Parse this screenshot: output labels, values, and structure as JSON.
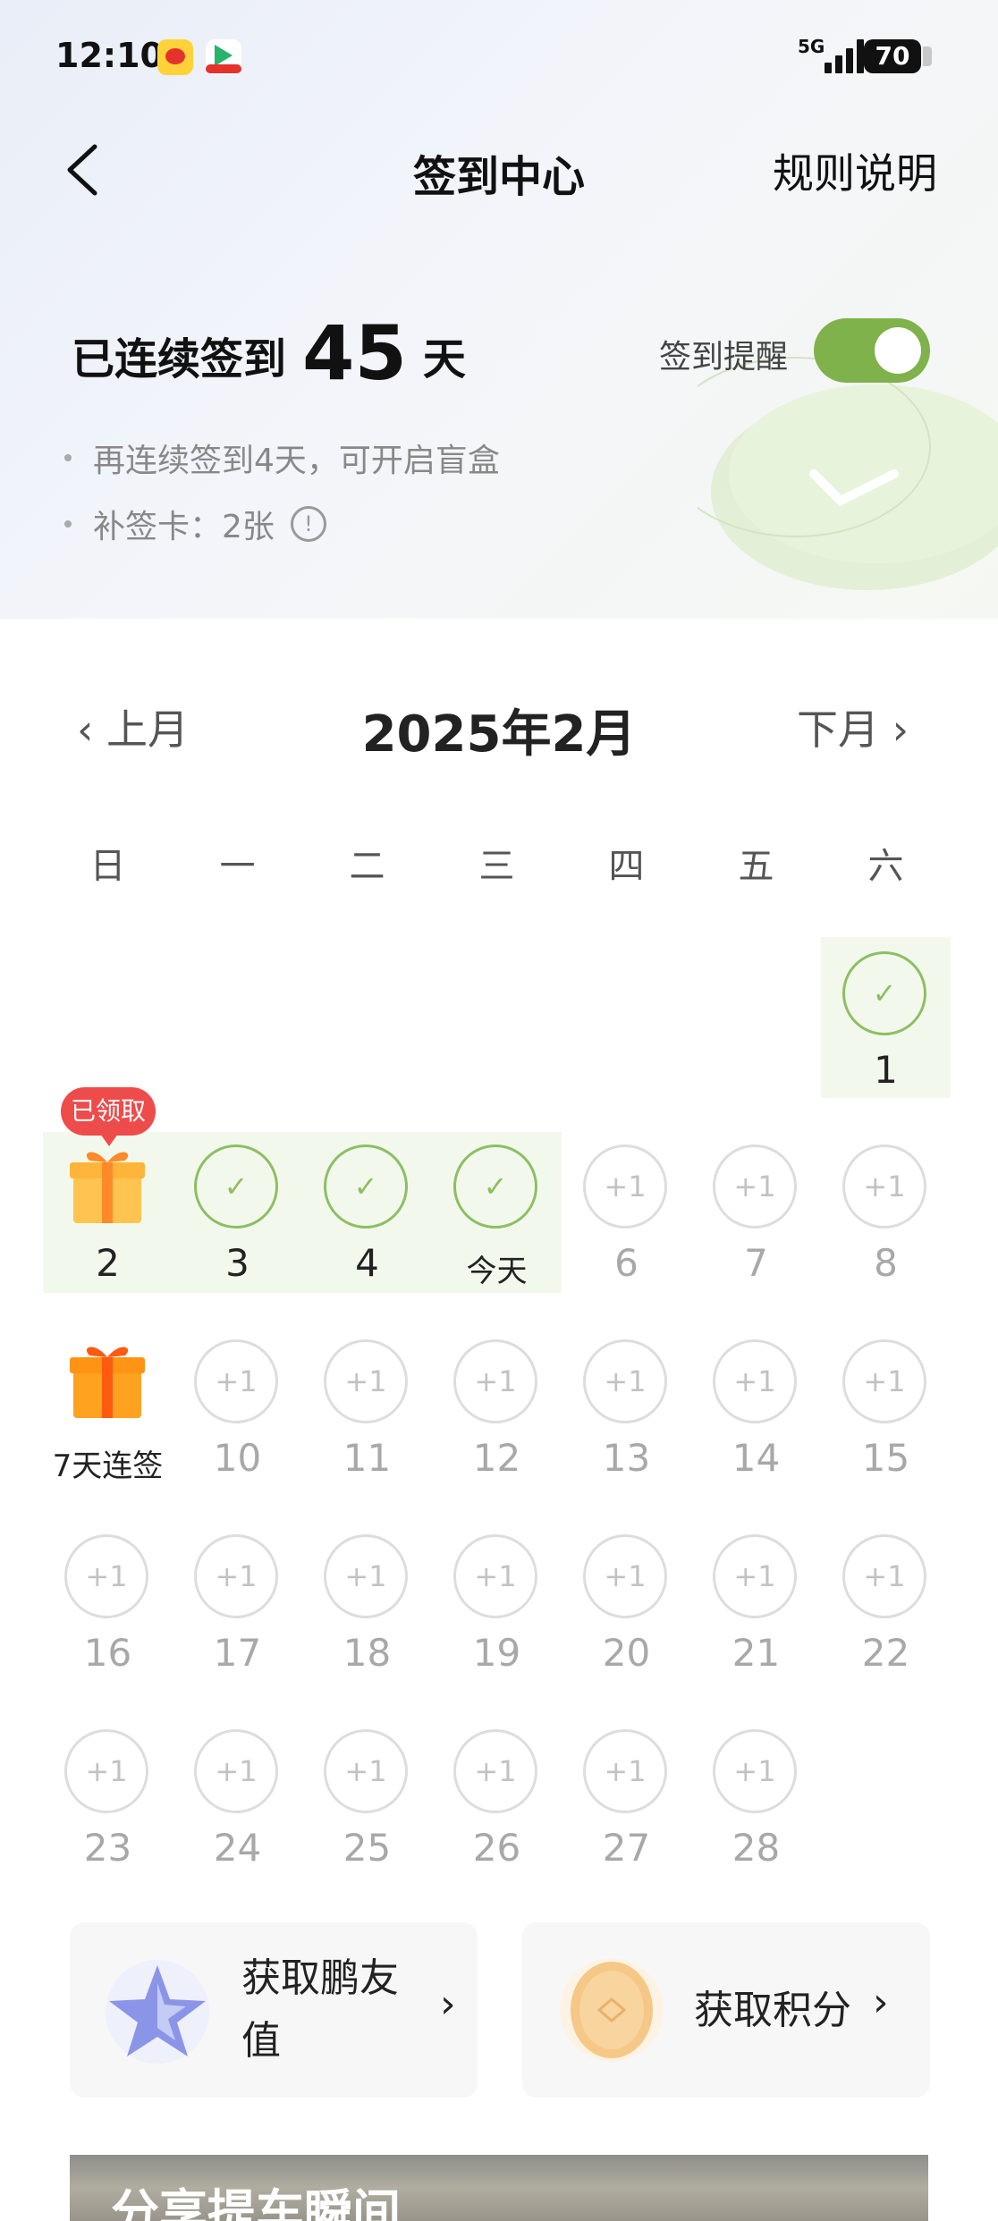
{
  "status": {
    "time": "12:10",
    "network": "5G",
    "battery": "70"
  },
  "header": {
    "title": "签到中心",
    "rules_label": "规则说明"
  },
  "streak": {
    "prefix": "已连续签到",
    "days": "45",
    "suffix": "天"
  },
  "reminder": {
    "label": "签到提醒",
    "enabled": true
  },
  "bullets": {
    "line1": "再连续签到4天，可开启盲盒",
    "line2": "补签卡：2张"
  },
  "calendar": {
    "prev_label": "上月",
    "month_label": "2025年2月",
    "next_label": "下月",
    "weekdays": [
      "日",
      "一",
      "二",
      "三",
      "四",
      "五",
      "六"
    ],
    "plus_label": "+1",
    "claimed_badge": "已领取",
    "days": {
      "d1": "1",
      "d2": "2",
      "d3": "3",
      "d4": "4",
      "today": "今天",
      "d6": "6",
      "d7": "7",
      "d8": "8",
      "gift7": "7天连签",
      "d10": "10",
      "d11": "11",
      "d12": "12",
      "d13": "13",
      "d14": "14",
      "d15": "15",
      "d16": "16",
      "d17": "17",
      "d18": "18",
      "d19": "19",
      "d20": "20",
      "d21": "21",
      "d22": "22",
      "d23": "23",
      "d24": "24",
      "d25": "25",
      "d26": "26",
      "d27": "27",
      "d28": "28"
    }
  },
  "cards": {
    "friend_value": "获取鹏友值",
    "points": "获取积分"
  },
  "banner": {
    "title": "分享提车瞬间"
  },
  "colors": {
    "accent_green": "#8cbf63",
    "toggle_green": "#7fb24a",
    "badge_red": "#ee4b4b"
  }
}
